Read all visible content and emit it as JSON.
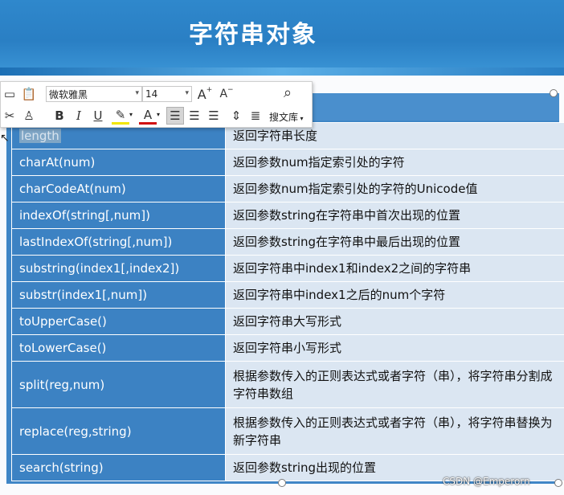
{
  "slide": {
    "title": "字符串对象"
  },
  "toolbar": {
    "font_name": "微软雅黑",
    "font_size": "14",
    "grow_font": "A",
    "shrink_font": "A",
    "bold": "B",
    "italic": "I",
    "underline": "U",
    "font_color": "A",
    "search_library": "搜文库"
  },
  "table": {
    "rows": [
      {
        "name": "length",
        "desc": "返回字符串长度"
      },
      {
        "name": "charAt(num)",
        "desc": "返回参数num指定索引处的字符"
      },
      {
        "name": "charCodeAt(num)",
        "desc": "返回参数num指定索引处的字符的Unicode值"
      },
      {
        "name": "indexOf(string[,num])",
        "desc": "返回参数string在字符串中首次出现的位置"
      },
      {
        "name": "lastIndexOf(string[,num])",
        "desc": "返回参数string在字符串中最后出现的位置"
      },
      {
        "name": "substring(index1[,index2])",
        "desc": "返回字符串中index1和index2之间的字符串"
      },
      {
        "name": "substr(index1[,num])",
        "desc": "返回字符串中index1之后的num个字符"
      },
      {
        "name": "toUpperCase()",
        "desc": "返回字符串大写形式"
      },
      {
        "name": "toLowerCase()",
        "desc": "返回字符串小写形式"
      },
      {
        "name": "split(reg,num)",
        "desc": "根据参数传入的正则表达式或者字符（串），将字符串分割成字符串数组"
      },
      {
        "name": "replace(reg,string)",
        "desc": "根据参数传入的正则表达式或者字符（串），将字符串替换为新字符串"
      },
      {
        "name": "search(string)",
        "desc": "返回参数string出现的位置"
      }
    ]
  },
  "watermark": "CSDN @Emperorn",
  "colors": {
    "banner": "#2a7fc4",
    "name_cell": "#3c82c3",
    "desc_cell": "#dbe6f2"
  }
}
